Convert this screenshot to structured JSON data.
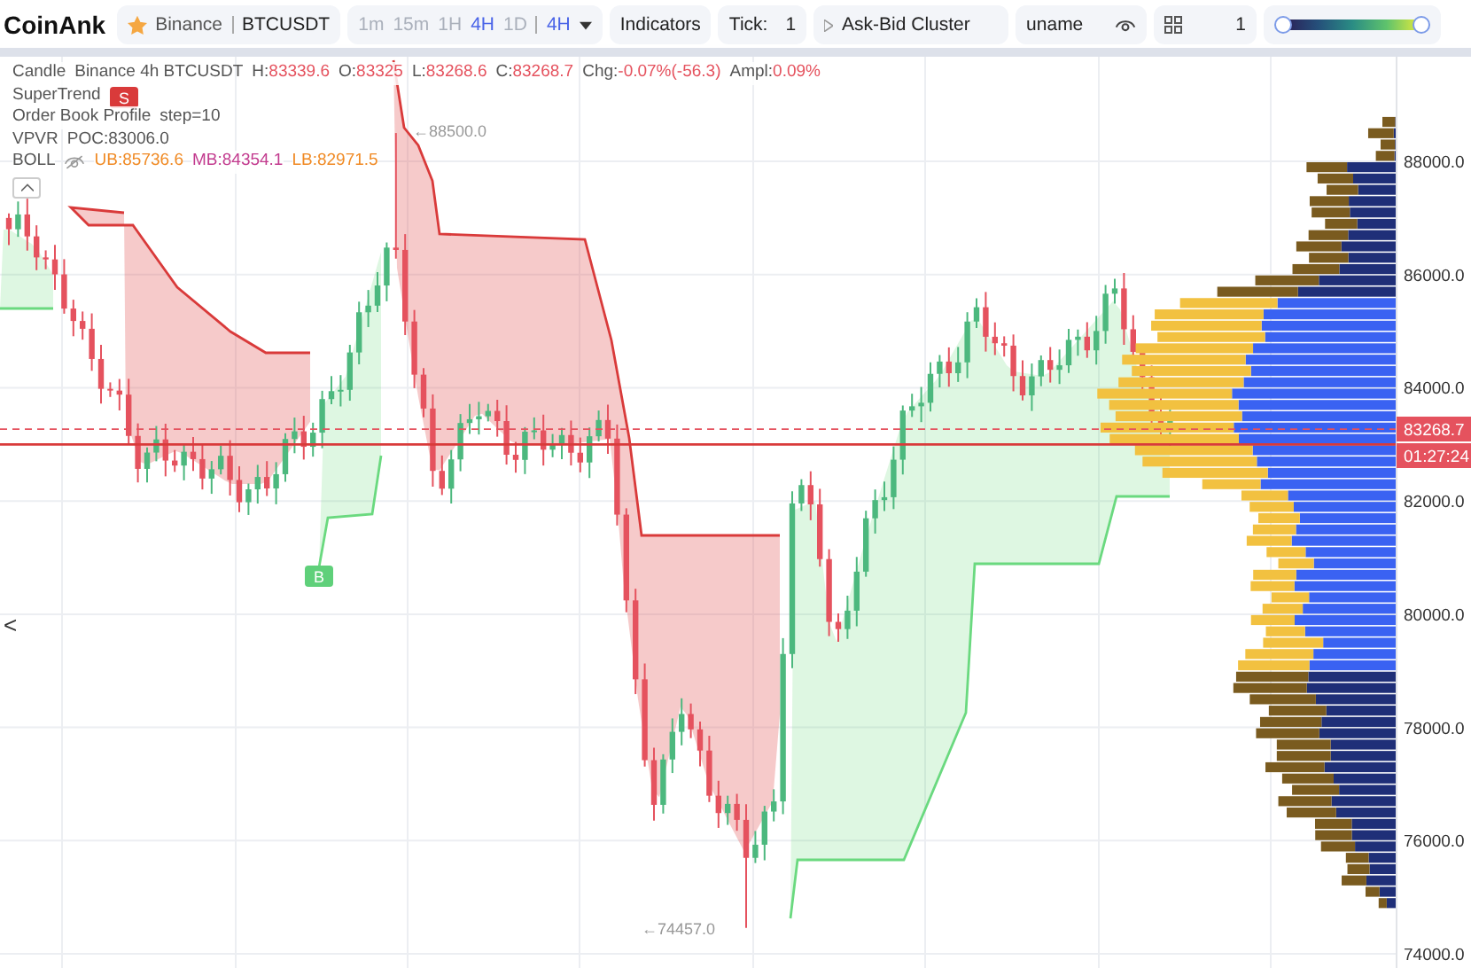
{
  "toolbar": {
    "logo": "CoinAnk",
    "favorite": true,
    "exchange": "Binance",
    "symbol": "BTCUSDT",
    "timeframes": [
      {
        "label": "1m",
        "selected": false
      },
      {
        "label": "15m",
        "selected": false
      },
      {
        "label": "1H",
        "selected": false
      },
      {
        "label": "4H",
        "selected": true
      },
      {
        "label": "1D",
        "selected": false
      }
    ],
    "current_timeframe": "4H",
    "indicators_button": "Indicators",
    "tick_label": "Tick:",
    "tick_value": "1",
    "cluster_button": "Ask-Bid Cluster",
    "user": "uname",
    "layout_count": "1",
    "color_range": [
      {
        "level": 0
      },
      {
        "level": 1
      }
    ]
  },
  "legend": [
    {
      "name": "Candle",
      "params": "Binance 4h BTCUSDT",
      "hidden": false,
      "values": [
        {
          "label": "H:",
          "value": "83339.6",
          "color": "#e5525e"
        },
        {
          "label": "O:",
          "value": "83325",
          "color": "#e5525e"
        },
        {
          "label": "L:",
          "value": "83268.6",
          "color": "#e5525e"
        },
        {
          "label": "C:",
          "value": "83268.7",
          "color": "#e5525e"
        },
        {
          "label": "Chg:",
          "value": "-0.07%(-56.3)",
          "color": "#e5525e"
        },
        {
          "label": "Ampl:",
          "value": "0.09%",
          "color": "#e5525e"
        }
      ]
    },
    {
      "name": "SuperTrend",
      "hidden": false
    },
    {
      "name": "Order Book Profile",
      "params": "step=10",
      "hidden": false
    },
    {
      "name": "VPVR",
      "params": "POC:83006.0",
      "hidden": false
    },
    {
      "name": "BOLL",
      "hidden": true,
      "values": [
        {
          "label": "UB:",
          "value": "85736.6",
          "color": "#f08a24"
        },
        {
          "label": "MB:",
          "value": "84354.1",
          "color": "#c23a8e"
        },
        {
          "label": "LB:",
          "value": "82971.5",
          "color": "#f08a24"
        }
      ]
    }
  ],
  "chart": {
    "markers": [
      {
        "kind": "sell",
        "label": "S"
      },
      {
        "kind": "buy",
        "label": "B"
      }
    ],
    "high_label": "←88500.0",
    "low_label": "←74457.0",
    "price_ticks": [
      "88000.0",
      "86000.0",
      "84000.0",
      "82000.0",
      "80000.0",
      "78000.0",
      "76000.0",
      "74000.0"
    ],
    "last_price": "83268.7",
    "countdown": "01:27:24",
    "back_arrow": "<"
  }
}
